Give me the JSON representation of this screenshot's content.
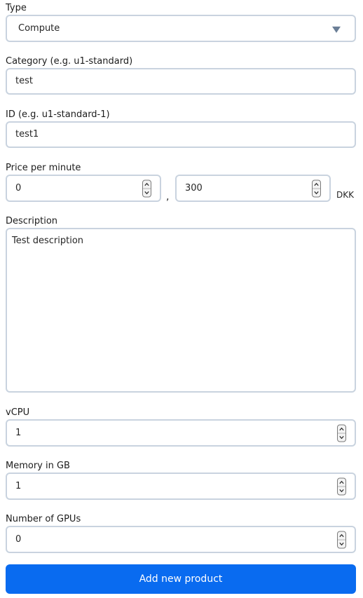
{
  "form": {
    "type": {
      "label": "Type",
      "value": "Compute"
    },
    "category": {
      "label": "Category (e.g. u1-standard)",
      "value": "test"
    },
    "id": {
      "label": "ID (e.g. u1-standard-1)",
      "value": "test1"
    },
    "price": {
      "label": "Price per minute",
      "whole": "0",
      "separator": ",",
      "fraction": "300",
      "currency": "DKK"
    },
    "description": {
      "label": "Description",
      "value": "Test description"
    },
    "vcpu": {
      "label": "vCPU",
      "value": "1"
    },
    "memory": {
      "label": "Memory in GB",
      "value": "1"
    },
    "gpus": {
      "label": "Number of GPUs",
      "value": "0"
    },
    "submit_label": "Add new product"
  },
  "icons": {
    "select_caret": "triangle-down-icon",
    "spinner_up": "chevron-up-icon",
    "spinner_down": "chevron-down-icon"
  },
  "colors": {
    "accent": "#096bf0",
    "border": "#c9d3df",
    "caret": "#6a7e96"
  }
}
